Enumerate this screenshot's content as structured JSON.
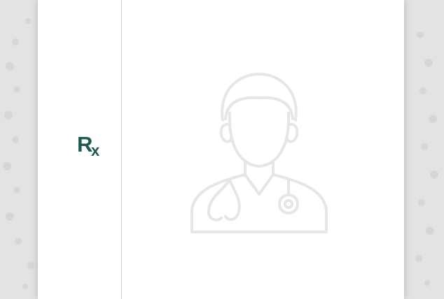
{
  "prescription_pad": {
    "rx_symbol": {
      "letter_r": "R",
      "letter_x": "x"
    },
    "watermark_icon": "doctor-stethoscope-icon"
  },
  "colors": {
    "background": "#e3e3e3",
    "paper": "#ffffff",
    "rx_green": "#1d5a4f",
    "divider": "#cfcfcf",
    "watermark_stroke": "#e6e6e6"
  }
}
